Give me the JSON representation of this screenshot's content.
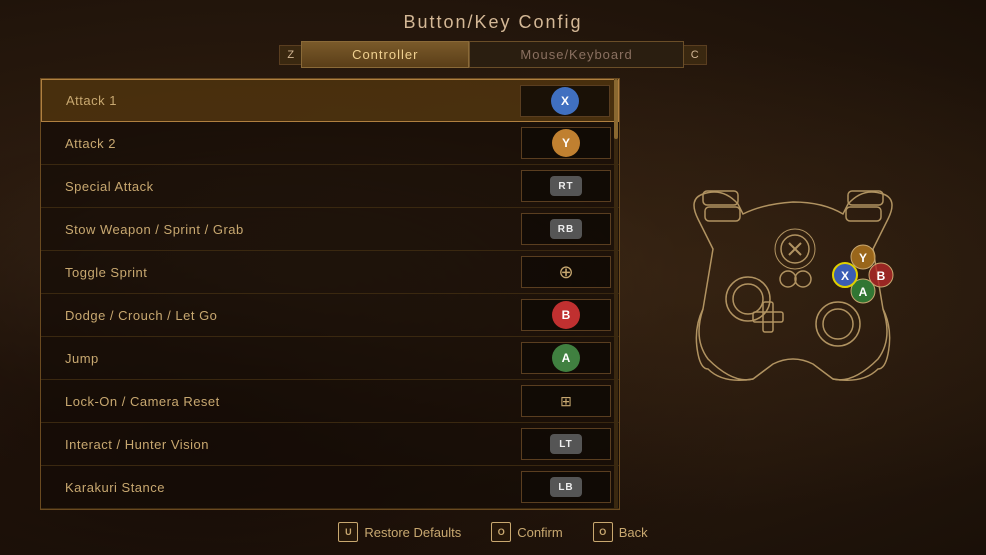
{
  "page": {
    "title": "Button/Key Config"
  },
  "tabs": {
    "left_icon": "Z",
    "right_icon": "C",
    "items": [
      {
        "id": "controller",
        "label": "Controller",
        "active": true
      },
      {
        "id": "mouse_keyboard",
        "label": "Mouse/Keyboard",
        "active": false
      }
    ]
  },
  "config_rows": [
    {
      "id": "attack1",
      "label": "Attack 1",
      "binding_type": "circle",
      "binding_color": "btn-x",
      "binding_label": "X",
      "selected": true
    },
    {
      "id": "attack2",
      "label": "Attack 2",
      "binding_type": "circle",
      "binding_color": "btn-y",
      "binding_label": "Y",
      "selected": false
    },
    {
      "id": "special_attack",
      "label": "Special Attack",
      "binding_type": "trigger",
      "binding_label": "RT",
      "selected": false
    },
    {
      "id": "stow_weapon",
      "label": "Stow Weapon / Sprint / Grab",
      "binding_type": "shoulder",
      "binding_label": "RB",
      "selected": false
    },
    {
      "id": "toggle_sprint",
      "label": "Toggle Sprint",
      "binding_type": "dpad",
      "binding_label": "↑",
      "selected": false
    },
    {
      "id": "dodge",
      "label": "Dodge / Crouch / Let Go",
      "binding_type": "circle",
      "binding_color": "btn-b",
      "binding_label": "B",
      "selected": false
    },
    {
      "id": "jump",
      "label": "Jump",
      "binding_type": "circle",
      "binding_color": "btn-a",
      "binding_label": "A",
      "selected": false
    },
    {
      "id": "lock_on",
      "label": "Lock-On / Camera Reset",
      "binding_type": "dpad2",
      "binding_label": "⊞",
      "selected": false
    },
    {
      "id": "interact",
      "label": "Interact / Hunter Vision",
      "binding_type": "trigger_left",
      "binding_label": "LT",
      "selected": false
    },
    {
      "id": "karakuri",
      "label": "Karakuri Stance",
      "binding_type": "shoulder_left",
      "binding_label": "LB",
      "selected": false
    }
  ],
  "bottom_bar": {
    "restore_icon": "U",
    "restore_label": "Restore Defaults",
    "confirm_icon": "O",
    "confirm_label": "Confirm",
    "back_icon": "O",
    "back_label": "Back"
  }
}
